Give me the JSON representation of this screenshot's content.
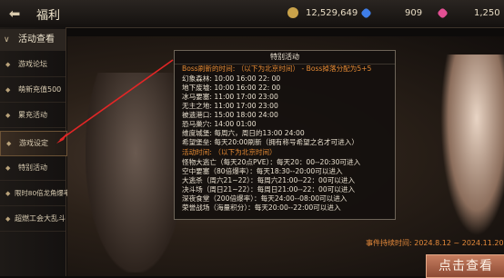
{
  "header": {
    "back_icon": "back-arrow-icon",
    "title": "福利",
    "currencies": [
      {
        "icon": "gold-coin-icon",
        "color": "#c9a24a",
        "value": "12,529,649"
      },
      {
        "icon": "blue-gem-icon",
        "color": "#3f7ee8",
        "value": "909"
      },
      {
        "icon": "pink-gem-icon",
        "color": "#e24f93",
        "value": "1,250"
      }
    ]
  },
  "sidebar": {
    "heading": "活动查看",
    "items": [
      {
        "label": "游戏论坛"
      },
      {
        "label": "萌新充值500"
      },
      {
        "label": "累充活动"
      },
      {
        "label": "游戏设定",
        "selected": true
      },
      {
        "label": "特别活动"
      },
      {
        "label": "限时80倍龙角爆率"
      },
      {
        "label": "超燃工会大乱斗"
      }
    ]
  },
  "panel": {
    "title": "特别活动",
    "boss_header": "Boss刷新的时间: （以下为北京时间） - Boss掉落分配为5+5",
    "boss_lines": [
      "幻象森林: 10:00   16:00   22: 00",
      "地下废墟: 10:00   16:00   22: 00",
      "冰马要塞: 11:00   17:00   23:00",
      "无主之地: 11:00   17:00   23:00",
      "被遗港口: 15:00   18:00   24:00",
      "恐马巢穴: 14:00   01:00",
      "维度城堡: 每周六，周日的13:00  24:00",
      "希望堡垒: 每天20:00刷新（拥有称号希望之名才可进入）"
    ],
    "activity_header": "活动时间: （以下为北京时间）",
    "activity_lines": [
      "怪物大逃亡（每天20点PVE）：每天20：00--20:30可进入",
      "空中要塞（80倍爆率）：每天18:30--20:00可以进入",
      "大逃杀（周六21~22）：每周六21:00--22：00可以进入",
      "决斗场（周日21~22）：每周日21:00--22：00可以进入",
      "深夜食堂（200倍爆率）：每天24:00--08:00可以进入",
      "荣誉战场（海量积分）：每天20:00--22:00可以进入"
    ]
  },
  "event_note": "事件持续时间: 2024.8.12 ~ 2024.11.20",
  "action_button": "点击查看"
}
